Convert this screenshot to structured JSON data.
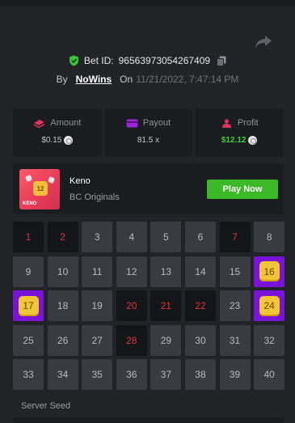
{
  "bet": {
    "label": "Bet ID:",
    "id": "96563973054267409"
  },
  "byline": {
    "by": "By",
    "user": "NoWins",
    "on": "On",
    "datetime": "11/21/2022, 7:47:14 PM"
  },
  "stats": {
    "amount": {
      "label": "Amount",
      "value": "$0.15",
      "icon": "stack-icon",
      "icon_color": "#e0325a"
    },
    "payout": {
      "label": "Payout",
      "value": "81.5 x",
      "icon": "card-icon",
      "icon_color": "#9b25d6"
    },
    "profit": {
      "label": "Profit",
      "value": "$12.12",
      "icon": "person-icon",
      "icon_color": "#e0325a",
      "value_color": "#3bd13b"
    }
  },
  "game": {
    "name": "Keno",
    "provider": "BC Originals",
    "play_label": "Play Now",
    "thumb_ball": "12",
    "thumb_name": "KENO"
  },
  "board": {
    "cells": [
      {
        "n": "1",
        "state": "drawn"
      },
      {
        "n": "2",
        "state": "drawn"
      },
      {
        "n": "3",
        "state": "none"
      },
      {
        "n": "4",
        "state": "none"
      },
      {
        "n": "5",
        "state": "none"
      },
      {
        "n": "6",
        "state": "none"
      },
      {
        "n": "7",
        "state": "drawn"
      },
      {
        "n": "8",
        "state": "none"
      },
      {
        "n": "9",
        "state": "none"
      },
      {
        "n": "10",
        "state": "none"
      },
      {
        "n": "11",
        "state": "none"
      },
      {
        "n": "12",
        "state": "none"
      },
      {
        "n": "13",
        "state": "none"
      },
      {
        "n": "14",
        "state": "none"
      },
      {
        "n": "15",
        "state": "none"
      },
      {
        "n": "16",
        "state": "hit"
      },
      {
        "n": "17",
        "state": "hit"
      },
      {
        "n": "18",
        "state": "none"
      },
      {
        "n": "19",
        "state": "none"
      },
      {
        "n": "20",
        "state": "drawn"
      },
      {
        "n": "21",
        "state": "drawn"
      },
      {
        "n": "22",
        "state": "drawn"
      },
      {
        "n": "23",
        "state": "none"
      },
      {
        "n": "24",
        "state": "hit"
      },
      {
        "n": "25",
        "state": "none"
      },
      {
        "n": "26",
        "state": "none"
      },
      {
        "n": "27",
        "state": "none"
      },
      {
        "n": "28",
        "state": "drawn"
      },
      {
        "n": "29",
        "state": "none"
      },
      {
        "n": "30",
        "state": "none"
      },
      {
        "n": "31",
        "state": "none"
      },
      {
        "n": "32",
        "state": "none"
      },
      {
        "n": "33",
        "state": "none"
      },
      {
        "n": "34",
        "state": "none"
      },
      {
        "n": "35",
        "state": "none"
      },
      {
        "n": "36",
        "state": "none"
      },
      {
        "n": "37",
        "state": "none"
      },
      {
        "n": "38",
        "state": "none"
      },
      {
        "n": "39",
        "state": "none"
      },
      {
        "n": "40",
        "state": "none"
      }
    ]
  },
  "seed": {
    "label": "Server Seed"
  },
  "colors": {
    "background": "#222326",
    "panel": "#1b1c1f",
    "cell": "#393b41",
    "drawn_text": "#e0353c",
    "hit": "#7b12d8",
    "gem": "#f0c637",
    "play": "#3cb926"
  }
}
